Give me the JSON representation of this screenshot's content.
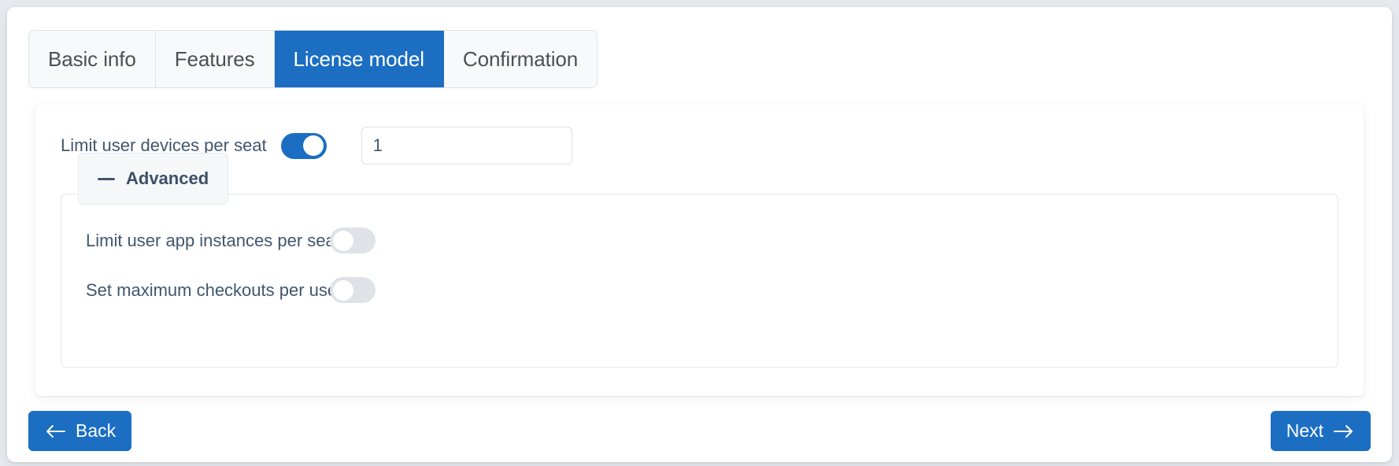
{
  "wizard": {
    "tabs": [
      {
        "label": "Basic info",
        "active": false
      },
      {
        "label": "Features",
        "active": false
      },
      {
        "label": "License model",
        "active": true
      },
      {
        "label": "Confirmation",
        "active": false
      }
    ]
  },
  "form": {
    "limit_devices": {
      "label": "Limit user devices per seat",
      "toggle_state": "on",
      "value": "1"
    },
    "advanced": {
      "legend": "Advanced",
      "collapse_icon": "minus-icon",
      "rows": [
        {
          "label": "Limit user app instances per seat",
          "toggle_state": "off"
        },
        {
          "label": "Set maximum checkouts per user",
          "toggle_state": "off"
        }
      ]
    }
  },
  "footer": {
    "back_label": "Back",
    "back_icon": "arrow-left-icon",
    "next_label": "Next",
    "next_icon": "arrow-right-icon"
  },
  "colors": {
    "accent": "#1b6ec2",
    "page_bg": "#e6eaee",
    "tab_bg": "#f8f9fa",
    "label_text": "#41566e",
    "toggle_off": "#dfe3e8"
  }
}
